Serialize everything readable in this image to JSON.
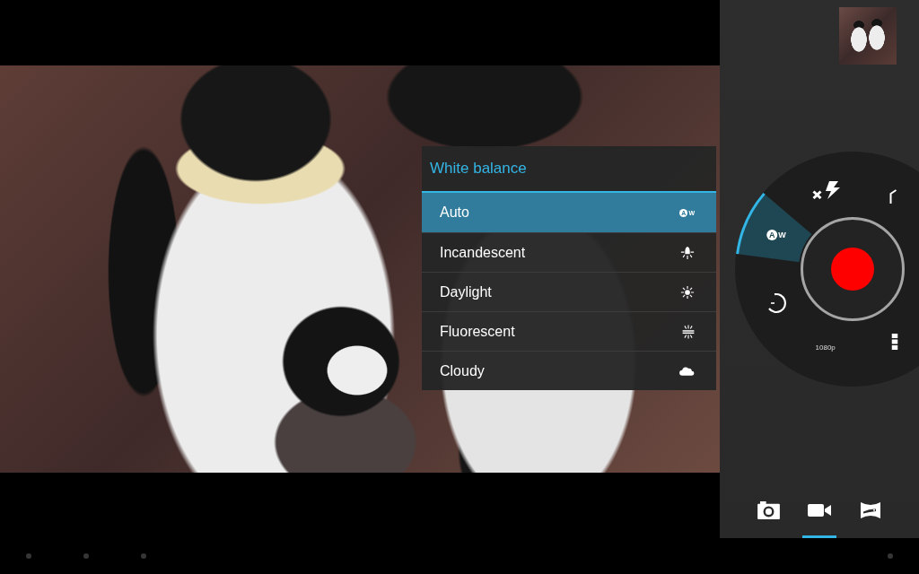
{
  "viewfinder": {
    "white_balance_menu": {
      "title": "White balance",
      "options": [
        {
          "kind": "auto",
          "label": "Auto",
          "icon_label": {
            "circled": "A",
            "plain": "W"
          },
          "selected": true
        },
        {
          "kind": "incandescent",
          "label": "Incandescent",
          "selected": false
        },
        {
          "kind": "daylight",
          "label": "Daylight",
          "selected": false
        },
        {
          "kind": "fluorescent",
          "label": "Fluorescent",
          "selected": false
        },
        {
          "kind": "cloudy",
          "label": "Cloudy",
          "selected": false
        }
      ]
    }
  },
  "side_panel": {
    "wheel": {
      "items": [
        {
          "kind": "flash-off",
          "selected": false
        },
        {
          "kind": "angle",
          "selected": false
        },
        {
          "kind": "white-balance",
          "icon_label": {
            "circled": "A",
            "plain": "W"
          },
          "selected": true
        },
        {
          "kind": "timer",
          "selected": false
        },
        {
          "kind": "resolution",
          "label": "1080p",
          "selected": false
        },
        {
          "kind": "more",
          "selected": false
        }
      ]
    },
    "modes": [
      {
        "kind": "photo",
        "selected": false
      },
      {
        "kind": "video",
        "selected": true
      },
      {
        "kind": "panorama",
        "selected": false
      }
    ]
  }
}
